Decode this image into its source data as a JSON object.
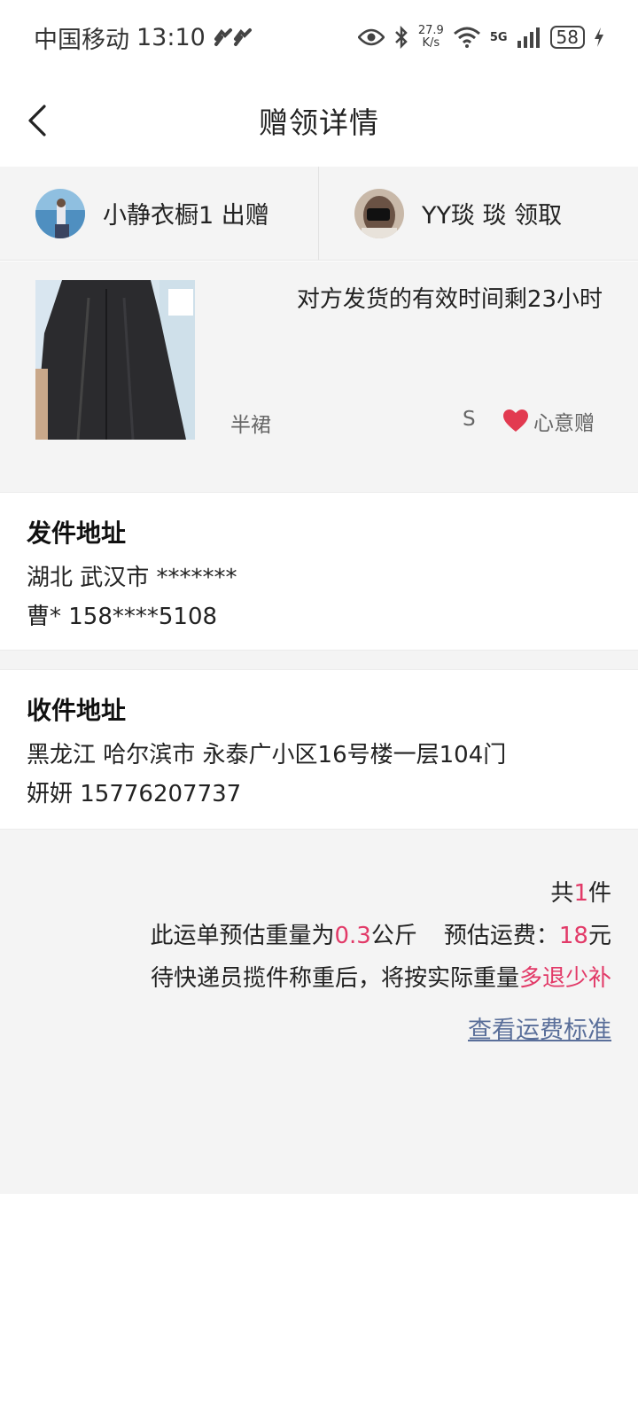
{
  "status_bar": {
    "carrier": "中国移动",
    "time": "13:10",
    "speed_value": "27.9",
    "speed_unit": "K/s",
    "network": "5G",
    "battery": "58"
  },
  "header": {
    "title": "赠领详情"
  },
  "giver": {
    "name_action": "小静衣橱1 出赠"
  },
  "receiver": {
    "name_action": "YY琰  琰 领取"
  },
  "product": {
    "deadline": "对方发货的有效时间剩23小时",
    "category": "半裙",
    "size": "S",
    "tag": "心意赠"
  },
  "send_address": {
    "title": "发件地址",
    "address": "湖北 武汉市 *******",
    "contact": "曹* 158****5108"
  },
  "receive_address": {
    "title": "收件地址",
    "address": "黑龙江 哈尔滨市 永泰广小区16号楼一层104门",
    "contact": "妍妍 15776207737"
  },
  "shipping": {
    "count_prefix": "共",
    "count": "1",
    "count_suffix": "件",
    "weight_prefix": "此运单预估重量为",
    "weight": "0.3",
    "weight_unit": "公斤",
    "fee_prefix": "预估运费：",
    "fee": "18",
    "fee_unit": "元",
    "note_prefix": "待快递员揽件称重后，将按实际重量",
    "note_highlight": "多退少补",
    "fee_link": "查看运费标准"
  },
  "colors": {
    "accent": "#e23a68",
    "link": "#5a6f9a",
    "panel": "#f4f4f4"
  }
}
